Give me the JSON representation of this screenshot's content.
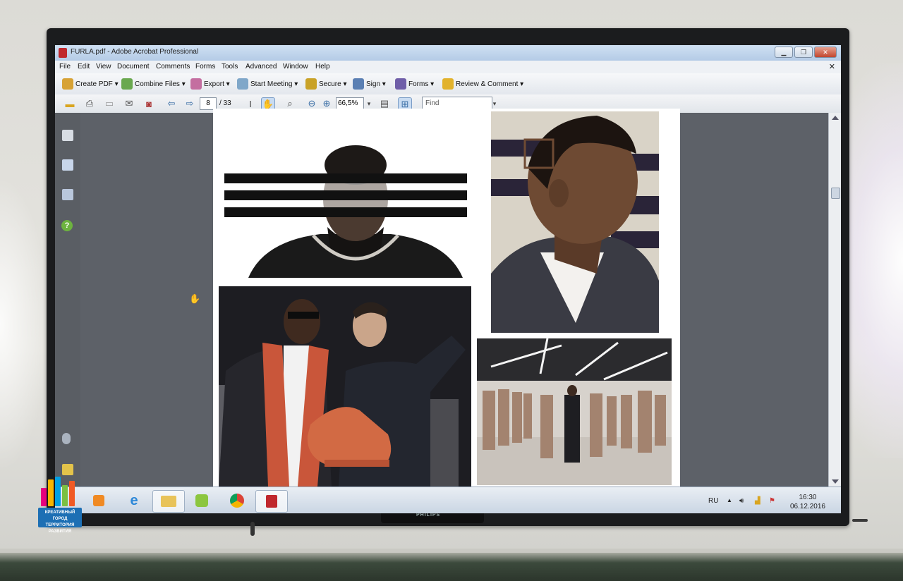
{
  "window": {
    "title": "FURLA.pdf - Adobe Acrobat Professional",
    "controls": [
      "▁",
      "❐",
      "✕"
    ]
  },
  "menu": [
    "File",
    "Edit",
    "View",
    "Document",
    "Comments",
    "Forms",
    "Tools",
    "Advanced",
    "Window",
    "Help"
  ],
  "toolbar_tasks": [
    {
      "label": "Create PDF ▾",
      "icon": "create-pdf-icon",
      "color": "#d7a235"
    },
    {
      "label": "Combine Files ▾",
      "icon": "combine-files-icon",
      "color": "#6aa84f"
    },
    {
      "label": "Export ▾",
      "icon": "export-icon",
      "color": "#c46ea0"
    },
    {
      "label": "Start Meeting ▾",
      "icon": "meeting-icon",
      "color": "#7fa7c9"
    },
    {
      "label": "Secure ▾",
      "icon": "lock-icon",
      "color": "#c9a227"
    },
    {
      "label": "Sign ▾",
      "icon": "pen-icon",
      "color": "#5a7fb3"
    },
    {
      "label": "Forms ▾",
      "icon": "forms-icon",
      "color": "#6f5ea8"
    },
    {
      "label": "Review & Comment ▾",
      "icon": "review-icon",
      "color": "#e2b22c"
    }
  ],
  "navigation": {
    "current_page": "8",
    "total_pages": "/ 33",
    "zoom": "66,5%",
    "find_placeholder": "Find"
  },
  "taskbar": {
    "language": "RU",
    "time": "16:30",
    "date": "06.12.2016",
    "apps": [
      "media-player-icon",
      "internet-explorer-icon",
      "file-explorer-icon",
      "app-icon",
      "chrome-icon",
      "acrobat-icon"
    ]
  },
  "monitor_brand": "PHILIPS",
  "watermark": {
    "line1": "КРЕАТИВНЫЙ ГОРОД",
    "line2": "ТЕРРИТОРИЯ РАЗВИТИЯ"
  },
  "colors": {
    "accent_blue": "#3a6ea5",
    "titlebar": "#b4cbe6",
    "doc_bg": "#5d6168",
    "close_btn": "#c1452d",
    "pdf_red": "#c0282d"
  }
}
